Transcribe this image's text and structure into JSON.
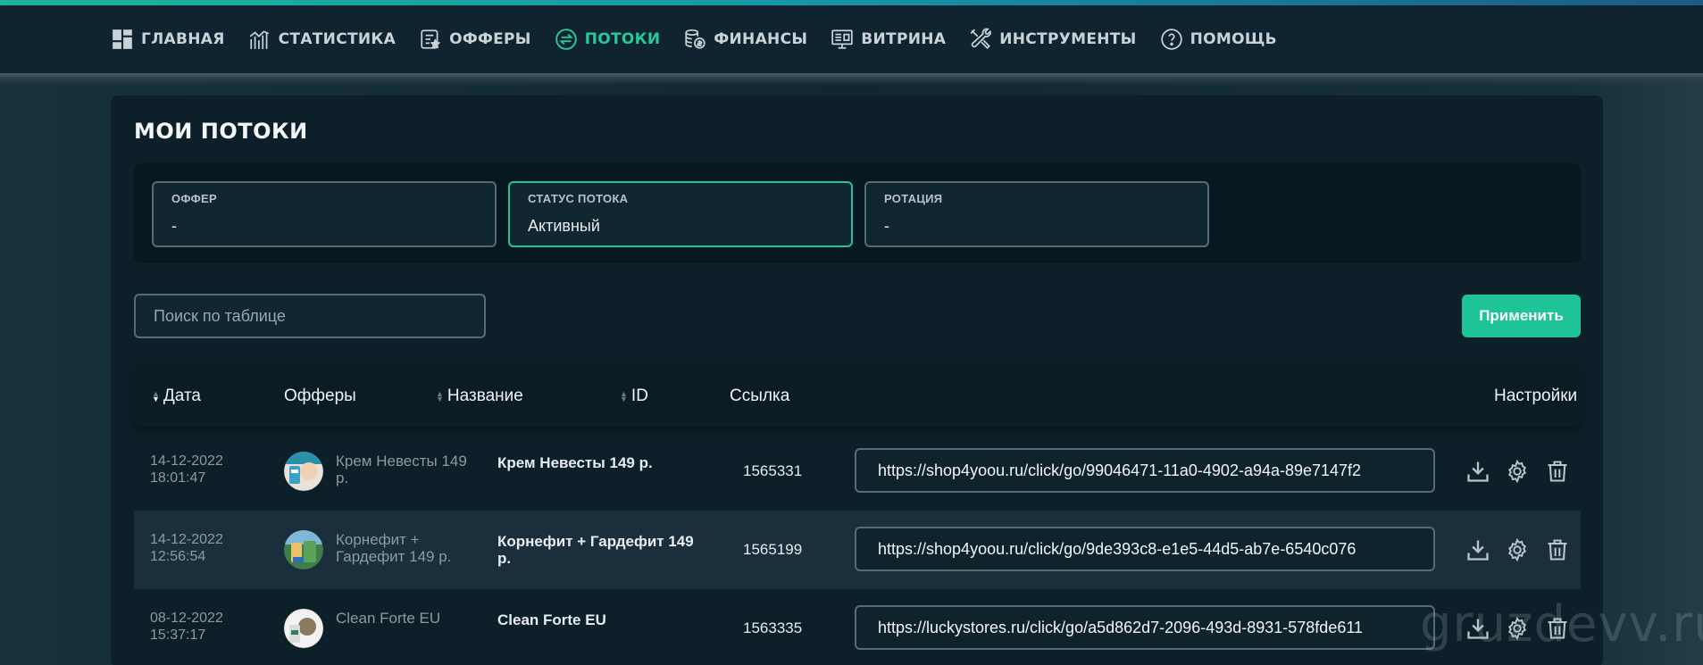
{
  "nav": {
    "items": [
      {
        "label": "ГЛАВНАЯ",
        "icon": "dashboard-icon"
      },
      {
        "label": "СТАТИСТИКА",
        "icon": "stats-icon"
      },
      {
        "label": "ОФФЕРЫ",
        "icon": "offers-icon"
      },
      {
        "label": "ПОТОКИ",
        "icon": "streams-icon",
        "active": true
      },
      {
        "label": "ФИНАНСЫ",
        "icon": "finance-icon"
      },
      {
        "label": "ВИТРИНА",
        "icon": "showcase-icon"
      },
      {
        "label": "ИНСТРУМЕНТЫ",
        "icon": "tools-icon"
      },
      {
        "label": "ПОМОЩЬ",
        "icon": "help-icon"
      }
    ],
    "active_color": "#27c89a"
  },
  "page": {
    "title": "МОИ ПОТОКИ"
  },
  "filters": {
    "offer": {
      "label": "ОФФЕР",
      "value": "-"
    },
    "status": {
      "label": "СТАТУС ПОТОКА",
      "value": "Активный"
    },
    "rotation": {
      "label": "РОТАЦИЯ",
      "value": "-"
    }
  },
  "search": {
    "placeholder": "Поиск по таблице",
    "value": ""
  },
  "apply_label": "Применить",
  "accent_color": "#1ec398",
  "table": {
    "headers": {
      "date": "Дата",
      "offers": "Офферы",
      "name": "Название",
      "id": "ID",
      "link": "Ссылка",
      "settings": "Настройки"
    },
    "rows": [
      {
        "date": "14-12-2022",
        "time": "18:01:47",
        "offer": "Крем Невесты 149 р.",
        "name": "Крем Невесты 149 р.",
        "id": "1565331",
        "link": "https://shop4yoou.ru/click/go/99046471-11a0-4902-a94a-89e7147f2"
      },
      {
        "date": "14-12-2022",
        "time": "12:56:54",
        "offer": "Корнефит + Гардефит 149 р.",
        "name": "Корнефит + Гардефит 149 р.",
        "id": "1565199",
        "link": "https://shop4yoou.ru/click/go/9de393c8-e1e5-44d5-ab7e-6540c076"
      },
      {
        "date": "08-12-2022",
        "time": "15:37:17",
        "offer": "Clean Forte EU",
        "name": "Clean Forte EU",
        "id": "1563335",
        "link": "https://luckystores.ru/click/go/a5d862d7-2096-493d-8931-578fde611"
      }
    ]
  },
  "watermark": "gruzdevv.ru"
}
